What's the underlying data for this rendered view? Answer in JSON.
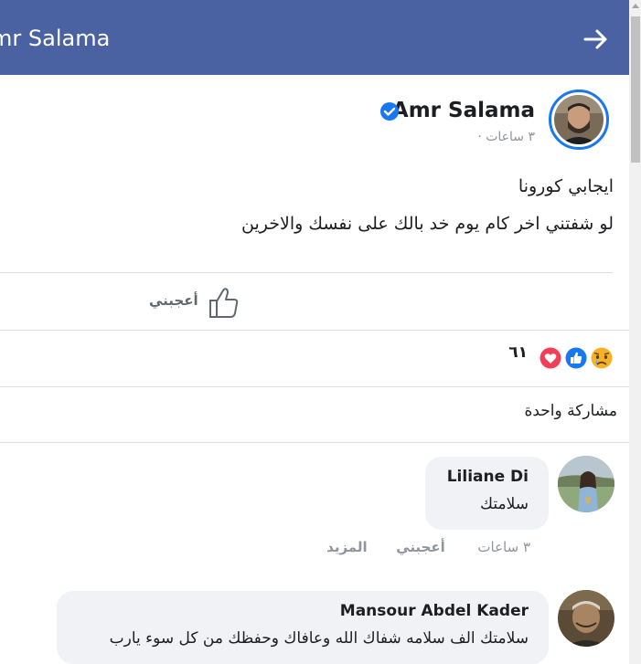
{
  "header": {
    "title": "mr Salama",
    "back_icon": "arrow-right-icon",
    "bg_color": "#4a62a1"
  },
  "post": {
    "author": "Amr Salama",
    "verified_icon": "verified-badge-icon",
    "meta": "٣ ساعات ·",
    "line1": "ايجابي كورونا",
    "line2": "لو شفتني اخر كام يوم خد بالك على نفسك والاخرين",
    "like_label": "أعجبني",
    "reactions_count": "٦١",
    "reaction_icons": [
      "sad-reaction-icon",
      "like-reaction-icon",
      "love-reaction-icon"
    ],
    "shares": "مشاركة واحدة"
  },
  "comments": [
    {
      "name": "Liliane Di",
      "text": "سلامتك",
      "time": "٣ ساعات",
      "like": "أعجبني",
      "more": "المزيد"
    },
    {
      "name": "Mansour Abdel Kader",
      "text": "سلامتك الف سلامه شفاك الله وعافاك وحفظك من كل سوء يارب"
    }
  ],
  "colors": {
    "accent": "#1877f2",
    "love": "#f33e58",
    "sad": "#f7b125",
    "bubble": "#f0f2f5"
  }
}
